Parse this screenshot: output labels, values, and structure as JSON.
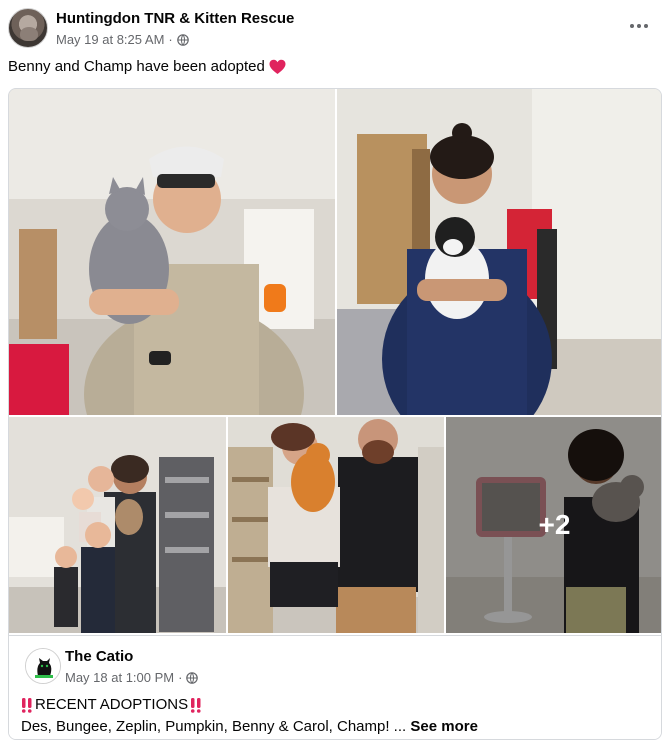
{
  "post": {
    "page_name": "Huntingdon TNR & Kitten Rescue",
    "timestamp": "May 19 at 8:25 AM",
    "separator": "·",
    "privacy_icon": "globe-icon",
    "text": "Benny and Champ have been adopted",
    "emoji": "heart-icon",
    "more_icon": "more-options-icon"
  },
  "media": {
    "photos": [
      {
        "label": "Man in cap and sunglasses holding gray cat"
      },
      {
        "label": "Woman in navy scrubs holding black and white cat"
      },
      {
        "label": "Family with children holding a cat"
      },
      {
        "label": "Couple holding an orange cat"
      },
      {
        "label": "Woman holding a cat next to a pet carrier"
      }
    ],
    "more_count": "+2"
  },
  "shared": {
    "page_name": "The Catio",
    "timestamp": "May 18 at 1:00 PM",
    "separator": "·",
    "privacy_icon": "globe-icon",
    "heading": "RECENT ADOPTIONS",
    "body": "Des, Bungee, Zeplin, Pumpkin, Benny & Carol, Champ! ...",
    "see_more": "See more"
  },
  "colors": {
    "text_primary": "#050505",
    "text_secondary": "#65676b",
    "border": "#d6d9dd",
    "heart": "#e0245e",
    "bang": "#e0245e"
  }
}
